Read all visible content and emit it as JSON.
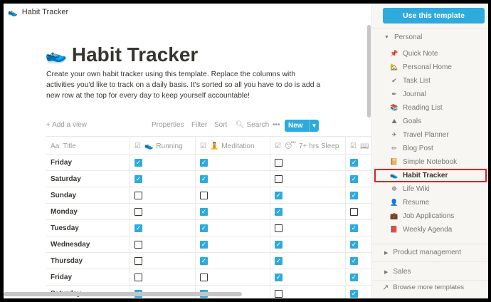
{
  "topbar": {
    "title": "Habit Tracker",
    "icon": "sneaker-icon"
  },
  "page": {
    "title": "Habit Tracker",
    "description": "Create your own habit tracker using this template. Replace the columns with activities you'd like to track on a daily basis. It's sorted so all you have to do is add a new row at the top for every day to keep yourself accountable!"
  },
  "viewbar": {
    "add_view": "+ Add a view",
    "properties": "Properties",
    "filter": "Filter",
    "sort": "Sort",
    "search": "Search",
    "more": "•••",
    "new": "New"
  },
  "table": {
    "columns": [
      "Title",
      "Running",
      "Meditation",
      "7+ hrs Sleep"
    ],
    "rows": [
      {
        "day": "Friday",
        "checks": [
          true,
          true,
          false,
          true
        ]
      },
      {
        "day": "Saturday",
        "checks": [
          true,
          true,
          false,
          true
        ]
      },
      {
        "day": "Sunday",
        "checks": [
          false,
          false,
          true,
          true
        ]
      },
      {
        "day": "Monday",
        "checks": [
          false,
          true,
          true,
          false
        ]
      },
      {
        "day": "Tuesday",
        "checks": [
          true,
          true,
          false,
          true
        ]
      },
      {
        "day": "Wednesday",
        "checks": [
          false,
          true,
          true,
          true
        ]
      },
      {
        "day": "Thursday",
        "checks": [
          false,
          true,
          true,
          true
        ]
      },
      {
        "day": "Friday",
        "checks": [
          false,
          false,
          true,
          true
        ]
      },
      {
        "day": "Saturday",
        "checks": [
          true,
          true,
          false,
          true
        ]
      }
    ]
  },
  "sidebar": {
    "use_template": "Use this template",
    "section_personal": "Personal",
    "items": [
      {
        "label": "Quick Note",
        "icon": "pushpin-icon",
        "glyph": "📌"
      },
      {
        "label": "Personal Home",
        "icon": "house-icon",
        "glyph": "🏡"
      },
      {
        "label": "Task List",
        "icon": "checkmark-icon",
        "glyph": "✔"
      },
      {
        "label": "Journal",
        "icon": "pen-icon",
        "glyph": "✒"
      },
      {
        "label": "Reading List",
        "icon": "books-icon",
        "glyph": "📚"
      },
      {
        "label": "Goals",
        "icon": "mountain-icon",
        "glyph": "⛰"
      },
      {
        "label": "Travel Planner",
        "icon": "airplane-icon",
        "glyph": "✈"
      },
      {
        "label": "Blog Post",
        "icon": "pencil-icon",
        "glyph": "✏"
      },
      {
        "label": "Simple Notebook",
        "icon": "notebook-icon",
        "glyph": "📔"
      },
      {
        "label": "Habit Tracker",
        "icon": "sneaker-icon",
        "glyph": "👟"
      },
      {
        "label": "Life Wiki",
        "icon": "lifebuoy-icon",
        "glyph": "☸"
      },
      {
        "label": "Resume",
        "icon": "person-icon",
        "glyph": "👤"
      },
      {
        "label": "Job Applications",
        "icon": "person-at-desk-icon",
        "glyph": "💼"
      },
      {
        "label": "Weekly Agenda",
        "icon": "book-icon",
        "glyph": "📕"
      }
    ],
    "selected_index": 9,
    "section_product": "Product management",
    "section_sales": "Sales",
    "browse_more": "Browse more templates"
  },
  "colors": {
    "accent": "#2eaadc",
    "selection_outline": "#dd2222",
    "sidebar_bg": "#f7f6f3"
  }
}
